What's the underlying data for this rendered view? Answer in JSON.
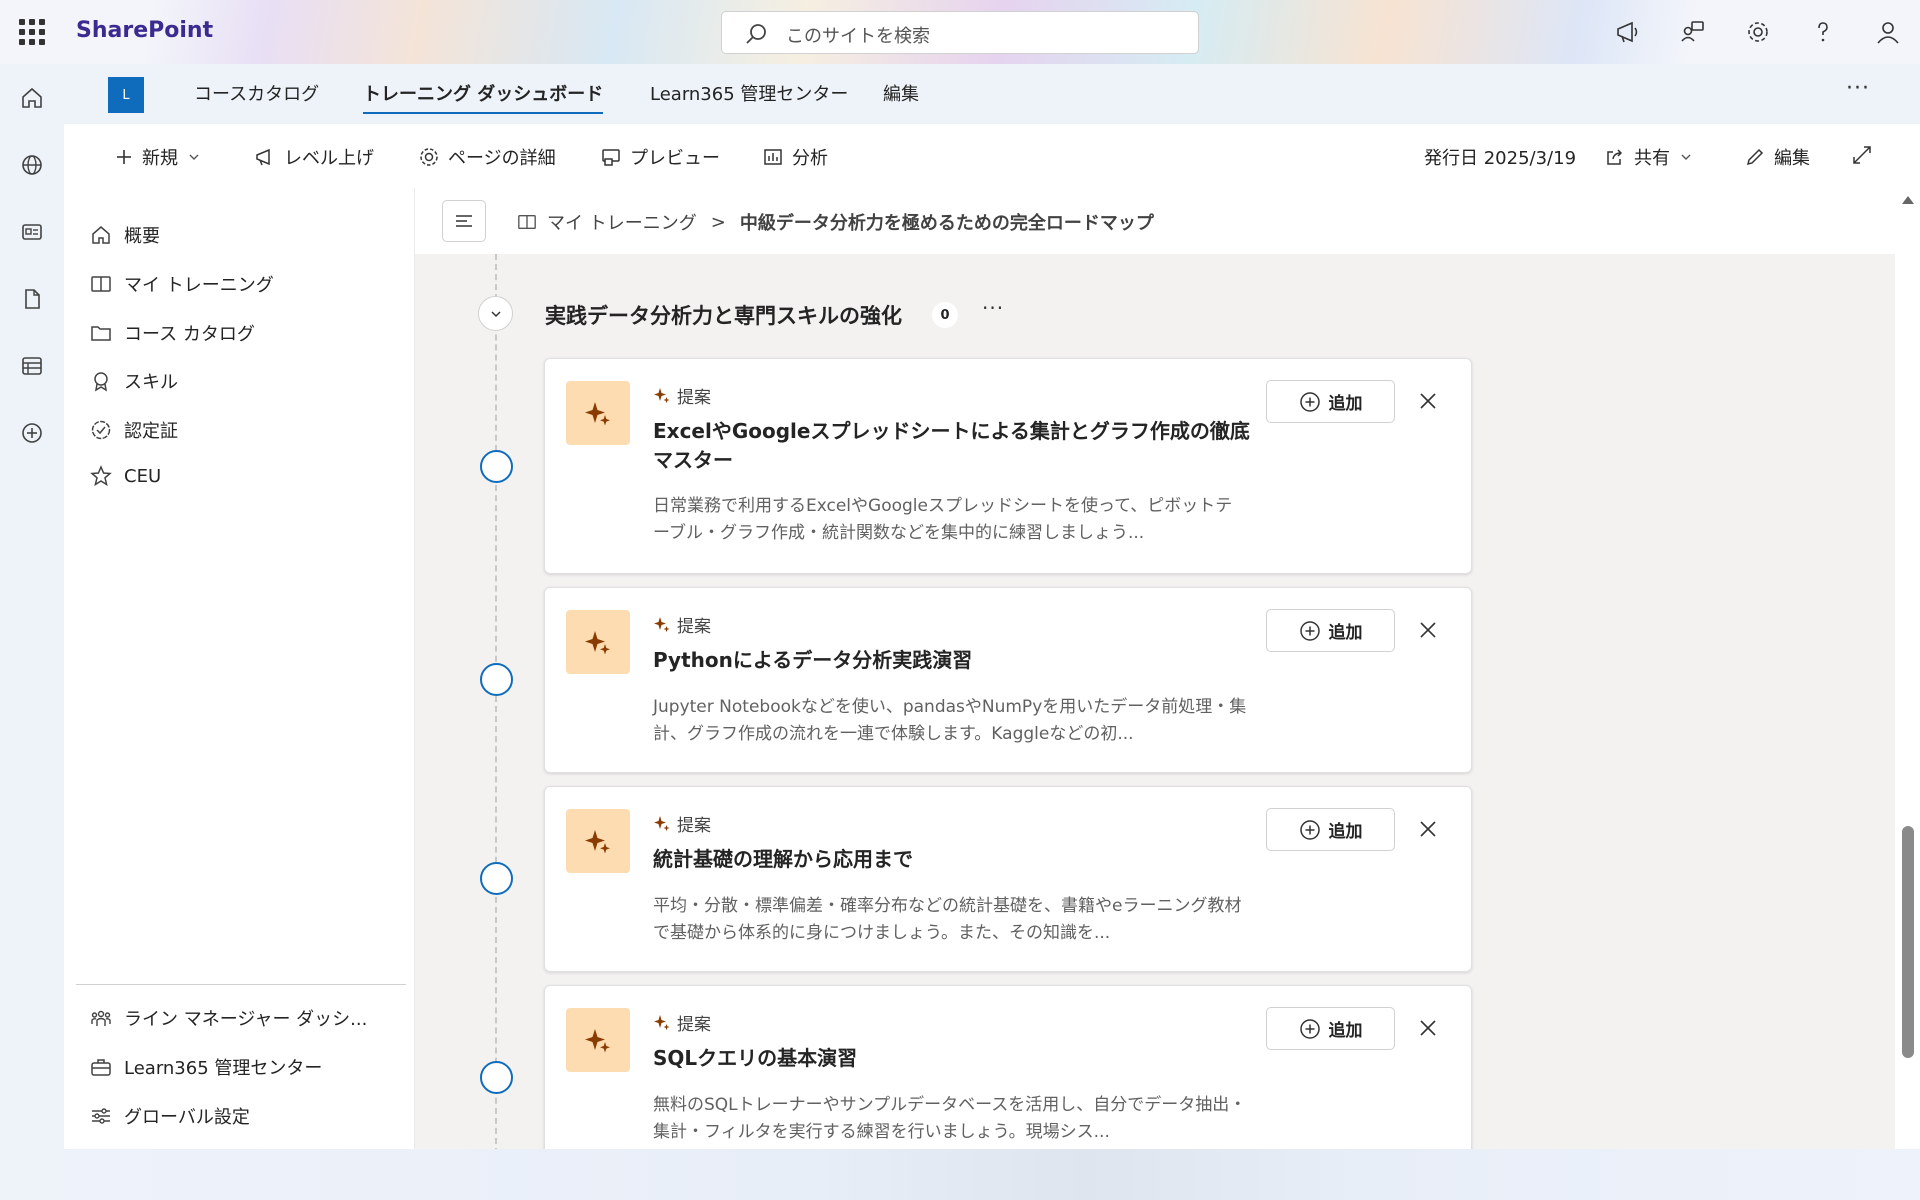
{
  "suite": {
    "brand": "SharePoint",
    "search_placeholder": "このサイトを検索"
  },
  "hubnav": {
    "logo_letter": "L",
    "tabs": [
      {
        "label": "コースカタログ"
      },
      {
        "label": "トレーニング ダッシュボード",
        "active": true
      },
      {
        "label": "Learn365 管理センター"
      },
      {
        "label": "編集"
      }
    ],
    "more": "···"
  },
  "commandbar": {
    "new": "新規",
    "level_up": "レベル上げ",
    "page_details": "ページの詳細",
    "preview": "プレビュー",
    "analytics": "分析",
    "published": "発行日 2025/3/19",
    "share": "共有",
    "edit": "編集"
  },
  "leftnav": {
    "items": [
      {
        "label": "概要",
        "icon": "home-icon"
      },
      {
        "label": "マイ トレーニング",
        "icon": "book-icon"
      },
      {
        "label": "コース カタログ",
        "icon": "folder-icon"
      },
      {
        "label": "スキル",
        "icon": "ribbon-icon"
      },
      {
        "label": "認定証",
        "icon": "certificate-icon"
      },
      {
        "label": "CEU",
        "icon": "star-icon"
      }
    ],
    "bottom_items": [
      {
        "label": "ライン マネージャー ダッシ...",
        "icon": "people-team-icon"
      },
      {
        "label": "Learn365 管理センター",
        "icon": "briefcase-icon"
      },
      {
        "label": "グローバル設定",
        "icon": "sliders-icon"
      }
    ]
  },
  "breadcrumb": {
    "parent": "マイ トレーニング",
    "separator": ">",
    "current": "中級データ分析力を極めるための完全ロードマップ"
  },
  "section": {
    "title": "実践データ分析力と専門スキルの強化",
    "count": "0",
    "more": "···"
  },
  "cards": [
    {
      "tag": "提案",
      "title": "ExcelやGoogleスプレッドシートによる集計とグラフ作成の徹底マスター",
      "description": "日常業務で利用するExcelやGoogleスプレッドシートを使って、ピボットテーブル・グラフ作成・統計関数などを集中的に練習しましょう...",
      "add_label": "追加"
    },
    {
      "tag": "提案",
      "title": "Pythonによるデータ分析実践演習",
      "description": "Jupyter Notebookなどを使い、pandasやNumPyを用いたデータ前処理・集計、グラフ作成の流れを一連で体験します。Kaggleなどの初...",
      "add_label": "追加"
    },
    {
      "tag": "提案",
      "title": "統計基礎の理解から応用まで",
      "description": "平均・分散・標準偏差・確率分布などの統計基礎を、書籍やeラーニング教材で基礎から体系的に身につけましょう。また、その知識を...",
      "add_label": "追加"
    },
    {
      "tag": "提案",
      "title": "SQLクエリの基本演習",
      "description": "無料のSQLトレーナーやサンプルデータベースを活用し、自分でデータ抽出・集計・フィルタを実行する練習を行いましょう。現場シス...",
      "add_label": "追加"
    }
  ],
  "colors": {
    "accent": "#0f6cbd",
    "brand_text": "#3b2a8f",
    "thumb_bg": "#fddcb1",
    "sparkle": "#8a3c00"
  }
}
